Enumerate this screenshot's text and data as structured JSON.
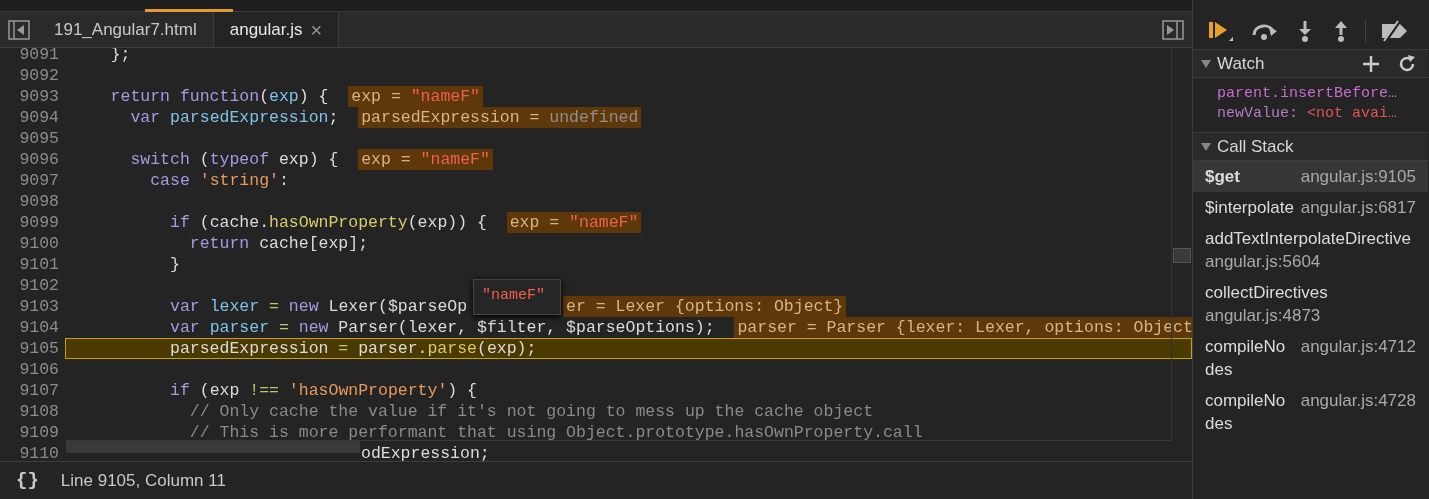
{
  "tabs": [
    {
      "label": "191_Angular7.html",
      "selected": false,
      "closable": false
    },
    {
      "label": "angular.js",
      "selected": true,
      "closable": true
    }
  ],
  "close_glyph": "×",
  "code": [
    {
      "number": "9091",
      "current": false,
      "tokens": [
        {
          "kind": "plain",
          "text": "    };"
        }
      ]
    },
    {
      "number": "9092",
      "current": false
    },
    {
      "number": "9093",
      "current": false,
      "tokens": [
        {
          "kind": "keyword",
          "text": "    return function"
        },
        {
          "kind": "plain",
          "text": "("
        },
        {
          "kind": "def",
          "text": "exp"
        },
        {
          "kind": "plain",
          "text": ") {"
        }
      ],
      "inline": {
        "name": "exp",
        "sign": "=",
        "value": "\"nameF\"",
        "kind": "string"
      }
    },
    {
      "number": "9094",
      "current": false,
      "tokens": [
        {
          "kind": "keyword",
          "text": "      var "
        },
        {
          "kind": "def",
          "text": "parsedExpression"
        },
        {
          "kind": "plain",
          "text": ";"
        }
      ],
      "inline": {
        "name": "parsedExpression",
        "sign": "=",
        "value": "undefined",
        "kind": "undefined"
      }
    },
    {
      "number": "9095",
      "current": false
    },
    {
      "number": "9096",
      "current": false,
      "tokens": [
        {
          "kind": "keyword",
          "text": "      switch"
        },
        {
          "kind": "plain",
          "text": " ("
        },
        {
          "kind": "keyword",
          "text": "typeof"
        },
        {
          "kind": "plain",
          "text": " exp) {"
        }
      ],
      "inline": {
        "name": "exp",
        "sign": "=",
        "value": "\"nameF\"",
        "kind": "string"
      }
    },
    {
      "number": "9097",
      "current": false,
      "tokens": [
        {
          "kind": "keyword",
          "text": "        case "
        },
        {
          "kind": "string",
          "text": "'string'"
        },
        {
          "kind": "plain",
          "text": ":"
        }
      ]
    },
    {
      "number": "9098",
      "current": false
    },
    {
      "number": "9099",
      "current": false,
      "tokens": [
        {
          "kind": "keyword",
          "text": "          if"
        },
        {
          "kind": "plain",
          "text": " (cache."
        },
        {
          "kind": "method",
          "text": "hasOwnProperty"
        },
        {
          "kind": "plain",
          "text": "(exp)) {"
        }
      ],
      "inline": {
        "name": "exp",
        "sign": "=",
        "value": "\"nameF\"",
        "kind": "string"
      }
    },
    {
      "number": "9100",
      "current": false,
      "tokens": [
        {
          "kind": "keyword",
          "text": "            return"
        },
        {
          "kind": "plain",
          "text": " cache[exp];"
        }
      ]
    },
    {
      "number": "9101",
      "current": false,
      "tokens": [
        {
          "kind": "plain",
          "text": "          }"
        }
      ]
    },
    {
      "number": "9102",
      "current": false
    },
    {
      "number": "9103",
      "current": false,
      "tokens": [
        {
          "kind": "keyword",
          "text": "          var "
        },
        {
          "kind": "def",
          "text": "lexer "
        },
        {
          "kind": "operator",
          "text": "= "
        },
        {
          "kind": "keyword",
          "text": "new"
        },
        {
          "kind": "plain",
          "text": " Lexer($parseOp"
        }
      ],
      "inline": {
        "name": "er",
        "sign": "=",
        "value": "Lexer {options: Object}",
        "kind": "object"
      }
    },
    {
      "number": "9104",
      "current": false,
      "tokens": [
        {
          "kind": "keyword",
          "text": "          var "
        },
        {
          "kind": "def",
          "text": "parser "
        },
        {
          "kind": "operator",
          "text": "= "
        },
        {
          "kind": "keyword",
          "text": "new"
        },
        {
          "kind": "plain",
          "text": " Parser(lexer, $filter, $parseOptions);"
        }
      ],
      "inline": {
        "name": "parser",
        "sign": "=",
        "value": "Parser {lexer: Lexer, options: Object",
        "kind": "object"
      }
    },
    {
      "number": "9105",
      "current": true,
      "tokens": [
        {
          "kind": "plain",
          "text": "          parsedExpression "
        },
        {
          "kind": "operator",
          "text": "="
        },
        {
          "kind": "plain",
          "text": " parser."
        },
        {
          "kind": "method",
          "text": "parse"
        },
        {
          "kind": "plain",
          "text": "(exp);"
        }
      ]
    },
    {
      "number": "9106",
      "current": false
    },
    {
      "number": "9107",
      "current": false,
      "tokens": [
        {
          "kind": "keyword",
          "text": "          if"
        },
        {
          "kind": "plain",
          "text": " (exp "
        },
        {
          "kind": "operator",
          "text": "!=="
        },
        {
          "kind": "string",
          "text": " 'hasOwnProperty'"
        },
        {
          "kind": "plain",
          "text": ") {"
        }
      ]
    },
    {
      "number": "9108",
      "current": false,
      "tokens": [
        {
          "kind": "comment",
          "text": "            // Only cache the value if it's not going to mess up the cache object"
        }
      ]
    },
    {
      "number": "9109",
      "current": false,
      "tokens": [
        {
          "kind": "comment",
          "text": "            // This is more performant that using Object.prototype.hasOwnProperty.call"
        }
      ]
    },
    {
      "number": "9110",
      "current": false,
      "tokens": [
        {
          "kind": "plain",
          "text": "odExpression;"
        }
      ]
    }
  ],
  "hover_tooltip": {
    "value": "\"nameF\""
  },
  "status_bar": {
    "pretty_print": "{}",
    "position": "Line 9105, Column 11"
  },
  "watch": {
    "title": "Watch",
    "expanded": true,
    "items": [
      {
        "expression": "parent.insertBefore…"
      },
      {
        "name": "newValue",
        "separator": ":",
        "value": "<not avai…"
      }
    ]
  },
  "call_stack": {
    "title": "Call Stack",
    "expanded": true,
    "frames": [
      {
        "name": "$get",
        "location": "angular.js:9105",
        "selected": true
      },
      {
        "name": "$interpolate",
        "location": "angular.js:6817",
        "selected": false
      },
      {
        "name": "addTextInterpolateDirective",
        "location": "angular.js:5604",
        "selected": false
      },
      {
        "name": "collectDirectives",
        "location": "angular.js:4873",
        "selected": false
      },
      {
        "name": "compileNodes",
        "location": "angular.js:4712",
        "selected": false
      },
      {
        "name": "compileNodes",
        "location": "angular.js:4728",
        "selected": false
      }
    ]
  }
}
